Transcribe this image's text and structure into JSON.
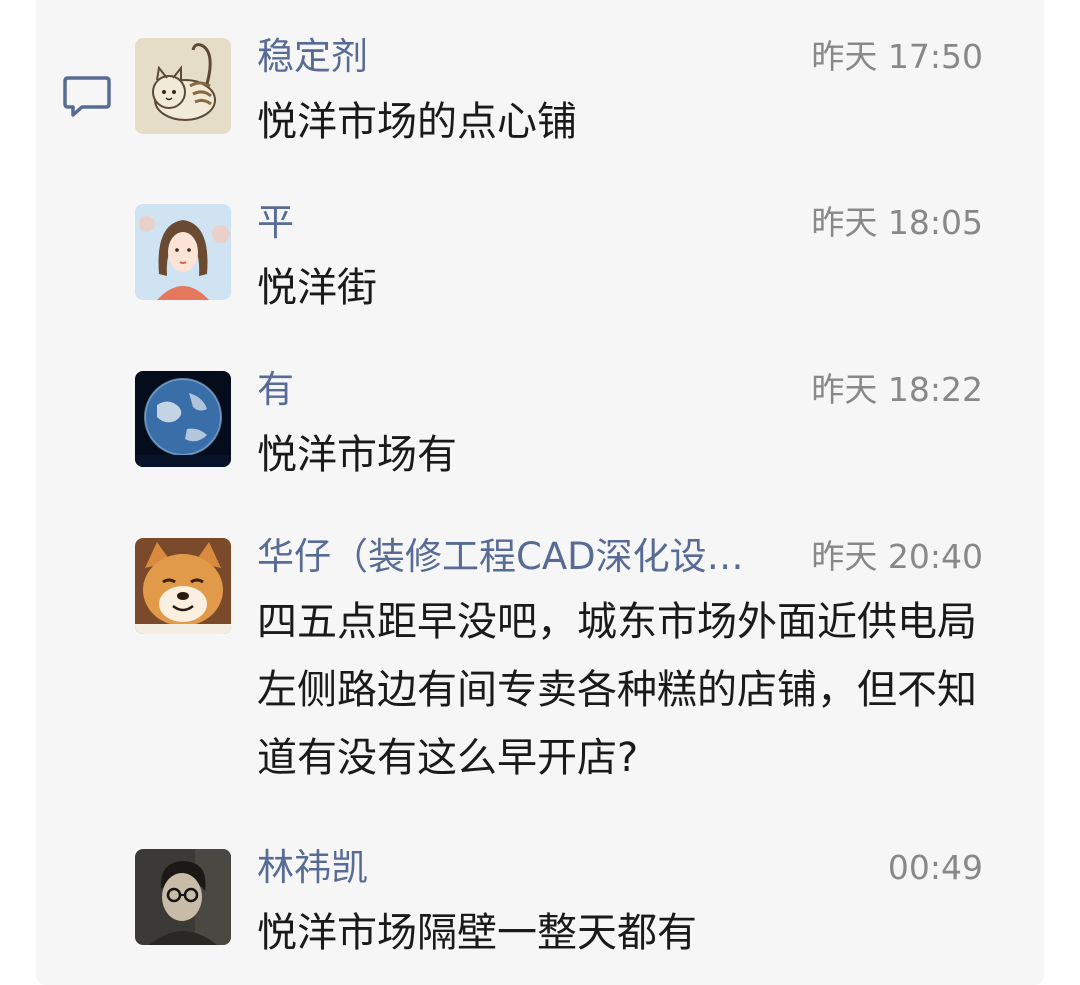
{
  "comments": [
    {
      "name": "稳定剂",
      "time": "昨天 17:50",
      "text": "悦洋市场的点心铺",
      "avatar": "cat-sketch-avatar"
    },
    {
      "name": "平",
      "time": "昨天 18:05",
      "text": "悦洋街",
      "avatar": "girl-illustration-avatar"
    },
    {
      "name": "有",
      "time": "昨天 18:22",
      "text": "悦洋市场有",
      "avatar": "earth-avatar"
    },
    {
      "name": "华仔（装修工程CAD深化设…",
      "time": "昨天 20:40",
      "text": "四五点距早没吧，城东市场外面近供电局左侧路边有间专卖各种糕的店铺，但不知道有没有这么早开店?",
      "avatar": "shiba-dog-avatar"
    },
    {
      "name": "林祎凯",
      "time": "00:49",
      "text": "悦洋市场隔壁一整天都有",
      "avatar": "man-photo-avatar"
    }
  ],
  "colors": {
    "name": "#576b95",
    "time": "#888888",
    "text": "#1a1a1a",
    "panel": "#f6f6f6"
  },
  "icons": {
    "comment": "comment-bubble-icon"
  }
}
